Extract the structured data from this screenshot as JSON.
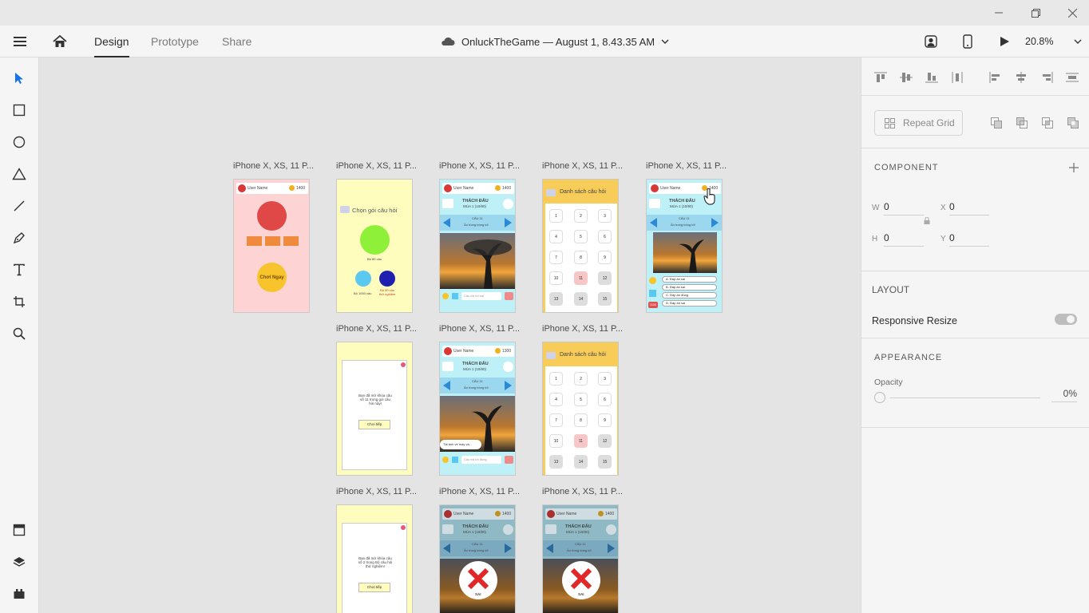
{
  "window": {
    "minimize_icon": "minimize-icon",
    "maximize_icon": "restore-icon",
    "close_icon": "close-icon"
  },
  "toolbar": {
    "menu_icon": "hamburger-menu-icon",
    "home_icon": "home-icon",
    "tabs": [
      {
        "label": "Design"
      },
      {
        "label": "Prototype"
      },
      {
        "label": "Share"
      }
    ],
    "document_title": "OnluckTheGame — August 1, 8.43.35 AM",
    "cloud_icon": "cloud-icon",
    "zoom": "20.8%"
  },
  "tools": [
    "select-icon",
    "rectangle-icon",
    "ellipse-icon",
    "polygon-icon",
    "line-icon",
    "pen-icon",
    "text-icon",
    "artboard-icon",
    "zoom-icon",
    "assets-icon",
    "layers-icon",
    "plugins-icon"
  ],
  "canvas": {
    "artboard_label": "iPhone X, XS, 11 P...",
    "artboards": {
      "a1": {
        "user": "User Name",
        "coins": "1400",
        "button": "Chơi Ngay"
      },
      "a2": {
        "title": "Chọn gói câu hỏi",
        "cap1": "Bộ 80 câu",
        "cap2": "Bộ 1000 câu",
        "cap3": "Bộ 50 câu\nthử nghiệm"
      },
      "a3": {
        "user": "User Name",
        "coins": "1400",
        "head1": "THÁCH ĐẤU",
        "head2": "MÙA 1 (10/80)",
        "q": "CÂU 11",
        "qsub": "Ẩn trong bóng tối",
        "answer": "Câu trả lời sai"
      },
      "a4": {
        "title": "Danh sách câu hỏi",
        "nums": [
          "1",
          "2",
          "3",
          "4",
          "5",
          "6",
          "7",
          "8",
          "9",
          "10",
          "11",
          "12",
          "13",
          "14",
          "15"
        ]
      },
      "a5": {
        "user": "User Name",
        "coins": "1400",
        "head1": "THÁCH ĐẤU",
        "head2": "MÙA 1 (10/80)",
        "q": "CÂU 11",
        "qsub": "Ẩn trong bóng tối",
        "opts": [
          "A. Đáp án sai",
          "B. Đáp án sai",
          "C. Đáp án đúng",
          "D. Đáp án sai"
        ],
        "badge": "D28"
      },
      "b2": {
        "msg": "Bạn đã mở khóa câu\nsố 11 trong gói câu\nhỏi này!",
        "btn": "Chơi tiếp"
      },
      "b3": {
        "user": "User Name",
        "coins": "1300",
        "head1": "THÁCH ĐẤU",
        "head2": "MÙA 1 (10/80)",
        "q": "CÂU 11",
        "qsub": "Ẩn trong bóng tối",
        "toast": "Tải ảnh về máy và...",
        "answer": "Câu trả lời đúng"
      },
      "b4": {
        "title": "Danh sách câu hỏi",
        "nums": [
          "1",
          "2",
          "3",
          "4",
          "5",
          "6",
          "7",
          "8",
          "9",
          "10",
          "11",
          "12",
          "13",
          "14",
          "15"
        ]
      },
      "c2": {
        "msg": "Bạn đã mở khóa câu\nsố 2 trong Bộ câu hỏi\nthử nghiệm!",
        "btn": "Chơi tiếp"
      },
      "c3": {
        "user": "User Name",
        "coins": "1400",
        "head1": "THÁCH ĐẤU",
        "head2": "MÙA 1 (10/80)",
        "q": "CÂU 11",
        "qsub": "Ẩn trong bóng tối",
        "result": "SAI"
      },
      "c4": {
        "user": "User Name",
        "coins": "1400",
        "head1": "THÁCH ĐẤU",
        "head2": "MÙA 1 (10/80)",
        "q": "CÂU 11",
        "qsub": "Ẩn trong bóng tối",
        "result": "SAI"
      }
    }
  },
  "right_panel": {
    "repeat_grid": "Repeat Grid",
    "component_head": "COMPONENT",
    "w_label": "W",
    "w_value": "0",
    "x_label": "X",
    "x_value": "0",
    "h_label": "H",
    "h_value": "0",
    "y_label": "Y",
    "y_value": "0",
    "layout_head": "LAYOUT",
    "responsive_resize": "Responsive Resize",
    "appearance_head": "APPEARANCE",
    "opacity_label": "Opacity",
    "opacity_value": "0%",
    "colors": {
      "accent": "#1473e6",
      "toggle_off": "#bdbdbd"
    }
  }
}
